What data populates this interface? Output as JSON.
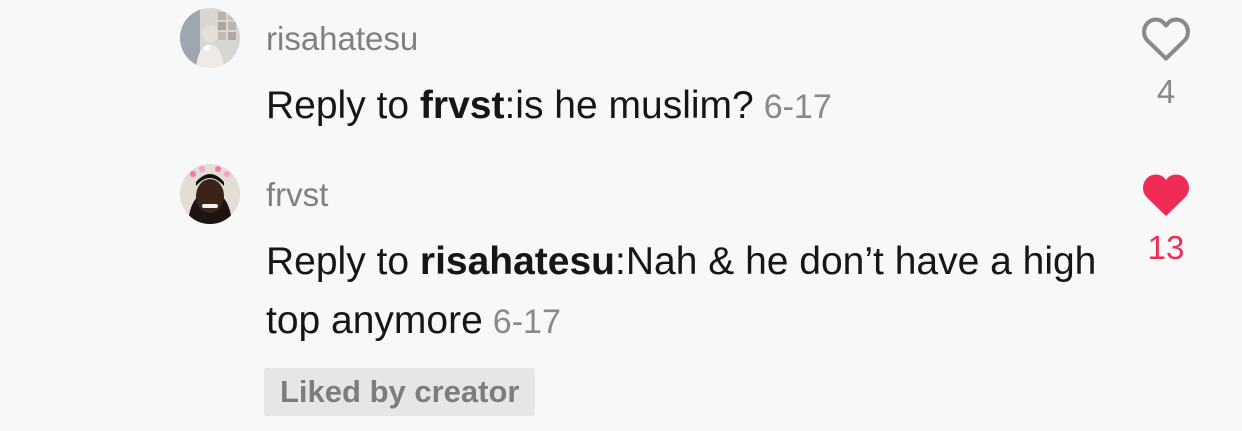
{
  "comments": [
    {
      "username": "risahatesu",
      "reply_prefix": "Reply to ",
      "reply_to": "frvst",
      "separator": ":",
      "text": "is he muslim?",
      "date": "6-17",
      "like_count": "4",
      "liked": false,
      "avatar_icon": "user-avatar-photo"
    },
    {
      "username": "frvst",
      "reply_prefix": "Reply to ",
      "reply_to": "risahatesu",
      "separator": ":",
      "text": "Nah & he don’t have a high top anymore",
      "date": "6-17",
      "like_count": "13",
      "liked": true,
      "avatar_icon": "user-avatar-photo",
      "badge": "Liked by creator"
    }
  ],
  "colors": {
    "liked_heart": "#ee2c55",
    "unliked_heart": "#8a8a8a",
    "background": "#f8f8f8",
    "badge_bg": "#e6e6e6"
  },
  "icons": {
    "unliked": "heart-outline-icon",
    "liked": "heart-filled-icon"
  }
}
